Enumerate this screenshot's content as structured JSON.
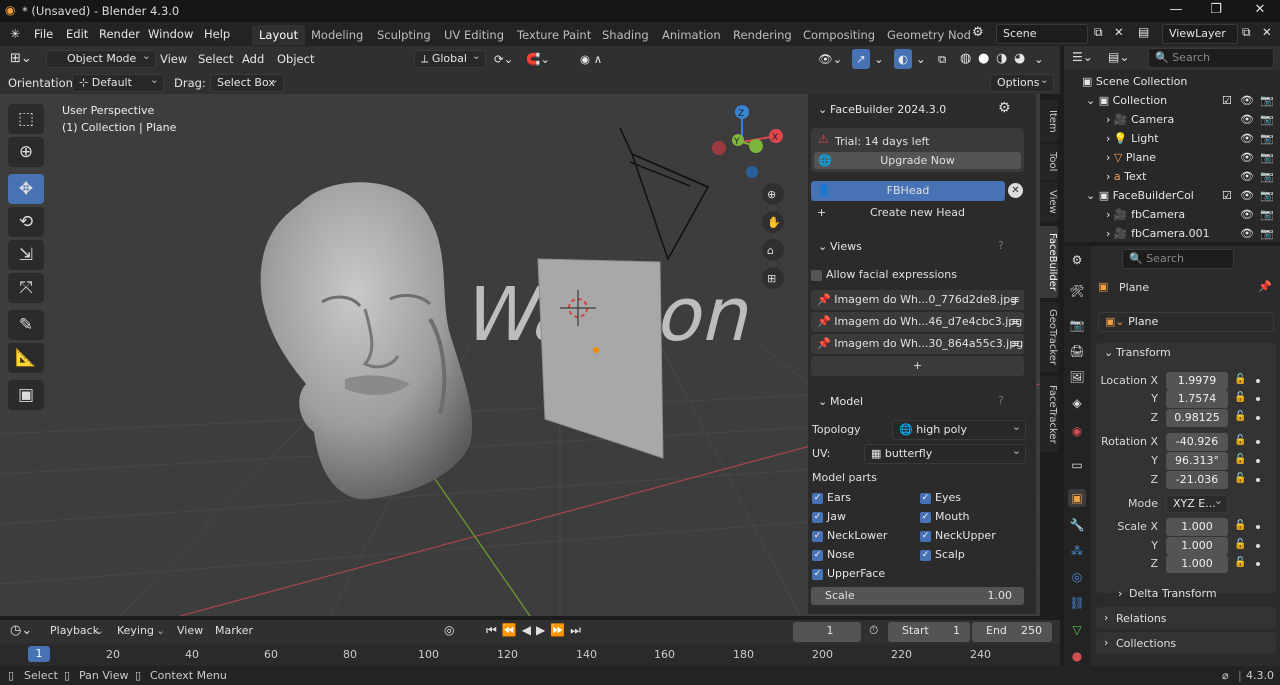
{
  "window": {
    "title": "* (Unsaved) - Blender 4.3.0",
    "controls": [
      "—",
      "❐",
      "✕"
    ]
  },
  "menu": [
    "File",
    "Edit",
    "Render",
    "Window",
    "Help"
  ],
  "workspaces": [
    "Layout",
    "Modeling",
    "Sculpting",
    "UV Editing",
    "Texture Paint",
    "Shading",
    "Animation",
    "Rendering",
    "Compositing",
    "Geometry Nod"
  ],
  "scene": {
    "name": "Scene",
    "viewlayer": "ViewLayer"
  },
  "viewport_header": {
    "mode": "Object Mode",
    "menus": [
      "View",
      "Select",
      "Add",
      "Object"
    ],
    "transform": "Global"
  },
  "tool_settings": {
    "orientation_label": "Orientation:",
    "orientation": "Default",
    "drag_label": "Drag:",
    "drag": "Select Box",
    "options": "Options"
  },
  "overlay_text": {
    "line1": "User Perspective",
    "line2": "(1) Collection | Plane"
  },
  "viewport_text3d": "Walison",
  "npanel": {
    "title": "FaceBuilder 2024.3.0",
    "trial": "Trial: 14 days left",
    "upgrade": "Upgrade Now",
    "head_name": "FBHead",
    "create_head": "Create new Head",
    "views_title": "Views",
    "allow_expr": "Allow facial expressions",
    "images": [
      "Imagem do Wh...0_776d2de8.jpg",
      "Imagem do Wh...46_d7e4cbc3.jpg",
      "Imagem do Wh...30_864a55c3.jpg"
    ],
    "add": "+",
    "model_title": "Model",
    "topology_label": "Topology",
    "topology": "high poly",
    "uv_label": "UV:",
    "uv": "butterfly",
    "parts_label": "Model parts",
    "parts_left": [
      "Ears",
      "Jaw",
      "NeckLower",
      "Nose",
      "UpperFace"
    ],
    "parts_right": [
      "Eyes",
      "Mouth",
      "NeckUpper",
      "Scalp"
    ],
    "scale_label": "Scale",
    "scale_value": "1.00"
  },
  "vertical_tabs": [
    "Item",
    "Tool",
    "View",
    "FaceBuilder",
    "GeoTracker",
    "FaceTracker"
  ],
  "outliner": {
    "search_placeholder": "Search",
    "rows": [
      "Scene Collection",
      "Collection",
      "Camera",
      "Light",
      "Plane",
      "Text",
      "FaceBuilderCol",
      "fbCamera",
      "fbCamera.001"
    ]
  },
  "properties": {
    "search_placeholder": "Search",
    "object_label": "Plane",
    "object_name": "Plane",
    "transform_title": "Transform",
    "location_label": "Location X",
    "rotation_label": "Rotation X",
    "scale_label": "Scale X",
    "axis_y": "Y",
    "axis_z": "Z",
    "location": [
      "1.9979",
      "1.7574",
      "0.98125"
    ],
    "rotation": [
      "-40.926",
      "96.313°",
      "-21.036"
    ],
    "scale": [
      "1.000",
      "1.000",
      "1.000"
    ],
    "mode_label": "Mode",
    "mode": "XYZ E...",
    "delta": "Delta Transform",
    "relations": "Relations",
    "collections": "Collections"
  },
  "timeline": {
    "menus": [
      "Playback",
      "Keying",
      "View",
      "Marker"
    ],
    "current_frame": "1",
    "start_label": "Start",
    "start": "1",
    "end_label": "End",
    "end": "250",
    "ruler": [
      "1",
      "20",
      "40",
      "60",
      "80",
      "100",
      "120",
      "140",
      "160",
      "180",
      "200",
      "220",
      "240"
    ]
  },
  "status": {
    "select": "Select",
    "pan": "Pan View",
    "context": "Context Menu",
    "version": "4.3.0"
  },
  "colors": {
    "accent": "#4772b3",
    "viewport": "#3d3d3d",
    "panel": "#2b2b2b",
    "gizmo_x": "#e0454e",
    "gizmo_y": "#7cb43c",
    "gizmo_z": "#3a82d2"
  }
}
